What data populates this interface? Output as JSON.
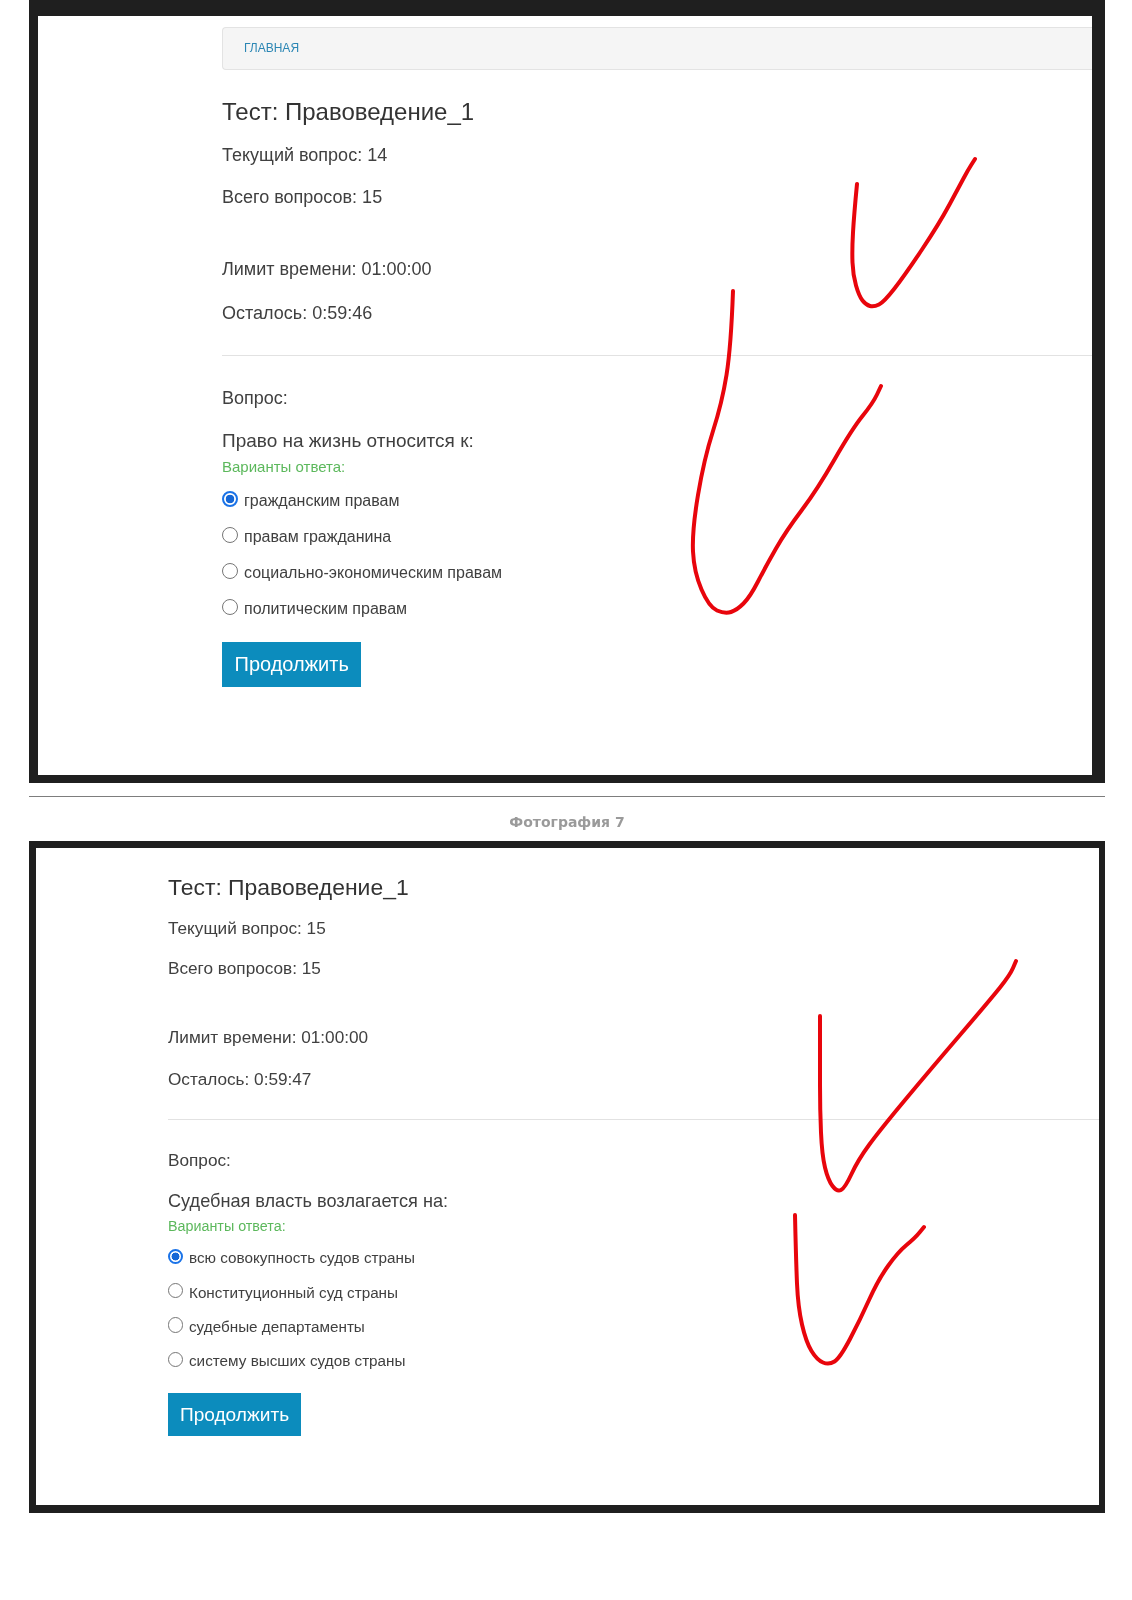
{
  "screenshots": [
    {
      "breadcrumb": {
        "label": "ГЛАВНАЯ"
      },
      "title": "Тест: Правоведение_1",
      "counter": {
        "current": "Текущий вопрос: 14",
        "total": "Всего вопросов: 15"
      },
      "timer": {
        "limit": "Лимит времени: 01:00:00",
        "remaining": "Осталось: 0:59:46"
      },
      "question": {
        "heading": "Вопрос:",
        "text": "Право на жизнь относится к:",
        "options_label": "Варианты ответа:",
        "options": [
          {
            "label": "гражданским правам",
            "selected": true
          },
          {
            "label": "правам гражданина",
            "selected": false
          },
          {
            "label": "социально-экономическим правам",
            "selected": false
          },
          {
            "label": "политическим правам",
            "selected": false
          }
        ]
      },
      "button": "Продолжить"
    },
    {
      "caption": "Фотография 7",
      "title": "Тест: Правоведение_1",
      "counter": {
        "current": "Текущий вопрос: 15",
        "total": "Всего вопросов: 15"
      },
      "timer": {
        "limit": "Лимит времени: 01:00:00",
        "remaining": "Осталось: 0:59:47"
      },
      "question": {
        "heading": "Вопрос:",
        "text": "Судебная власть возлагается на:",
        "options_label": "Варианты ответа:",
        "options": [
          {
            "label": "всю совокупность судов страны",
            "selected": true
          },
          {
            "label": "Конституционный суд страны",
            "selected": false
          },
          {
            "label": "судебные департаменты",
            "selected": false
          },
          {
            "label": "систему высших судов страны",
            "selected": false
          }
        ]
      },
      "button": "Продолжить"
    }
  ]
}
